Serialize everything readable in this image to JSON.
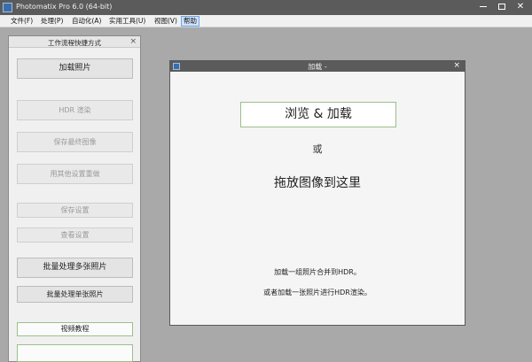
{
  "window": {
    "title": "Photomatix Pro 6.0 (64-bit)",
    "controls": {
      "minimize_icon": "minimize-icon",
      "maximize_icon": "maximize-icon",
      "close": "✕"
    }
  },
  "menu": {
    "items": [
      {
        "label": "文件(F)"
      },
      {
        "label": "处理(P)"
      },
      {
        "label": "自动化(A)"
      },
      {
        "label": "实用工具(U)"
      },
      {
        "label": "视图(V)"
      },
      {
        "label": "帮助",
        "active": true
      }
    ]
  },
  "workflow_panel": {
    "title": "工作流程快捷方式",
    "close": "×",
    "buttons": [
      {
        "label": "加载照片",
        "enabled": true
      },
      {
        "label": "HDR 渲染",
        "enabled": false
      },
      {
        "label": "保存最终图像",
        "enabled": false
      },
      {
        "label": "用其他设置重做",
        "enabled": false
      },
      {
        "label": "保存设置",
        "enabled": false
      },
      {
        "label": "查看设置",
        "enabled": false
      },
      {
        "label": "批量处理多张照片",
        "enabled": true
      },
      {
        "label": "批量处理单张照片",
        "enabled": true
      },
      {
        "label": "视频教程",
        "enabled": true
      }
    ]
  },
  "load_dialog": {
    "title": "加载 -",
    "close": "×",
    "browse_button": "浏览 & 加载",
    "or_text": "或",
    "drop_text": "拖放图像到这里",
    "hint_merge": "加载一组照片合并到HDR。",
    "hint_single": "或者加载一张照片进行HDR渲染。"
  },
  "colors": {
    "titlebar": "#5b5b5b",
    "workspace": "#a9a9a9",
    "menu_active": "#cfe3fb",
    "accent_outline": "#9cbf8a"
  }
}
